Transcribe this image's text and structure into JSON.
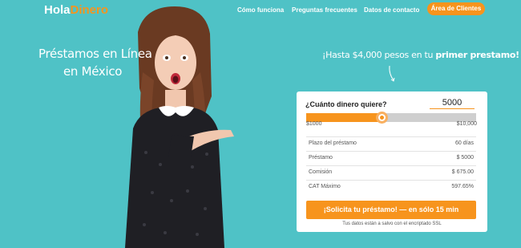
{
  "header": {
    "logo_part1": "Hola",
    "logo_part2": "Dinero",
    "nav": [
      {
        "label": "Cómo funciona"
      },
      {
        "label": "Preguntas frecuentes"
      },
      {
        "label": "Datos de contacto"
      }
    ],
    "client_area_label": "Área de Clientes"
  },
  "hero": {
    "line1": "Préstamos en Línea",
    "line2": "en México",
    "promo_prefix": "¡Hasta $4,000 pesos en tu ",
    "promo_bold": "primer prestamo!"
  },
  "calculator": {
    "question": "¿Cuánto dinero quiere?",
    "amount_value": "5000",
    "slider_value": 5000,
    "slider_min": 1000,
    "slider_max": 10000,
    "min_label": "$1000",
    "max_label": "$10,000",
    "rows": [
      {
        "label": "Plazo del préstamo",
        "value": "60 días"
      },
      {
        "label": "Préstamo",
        "value": "$ 5000"
      },
      {
        "label": "Comisión",
        "value": "$ 675.00"
      },
      {
        "label": "CAT Máximo",
        "value": "597.65%"
      }
    ],
    "cta_label": "¡Solicita tu préstamo! — en sólo 15 min",
    "secure_note": "Tus datos están a salvo con el encriptado SSL"
  },
  "colors": {
    "background": "#4fc2c6",
    "accent": "#f7941d",
    "card": "#ffffff"
  }
}
